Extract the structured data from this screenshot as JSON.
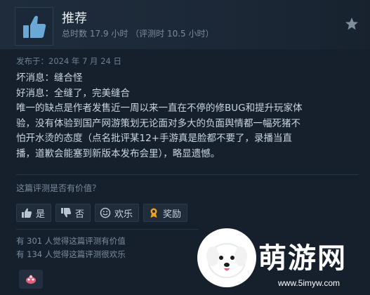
{
  "review": {
    "verdict": "推荐",
    "playtime": "总时数 17.9 小时 （评测时 10.5 小时）",
    "posted": "发布于：2024 年 7 月 24 日",
    "lines": [
      "坏消息：缝合怪",
      "好消息：全缝了，完美缝合",
      "唯一的缺点是作者发售近一周以来一直在不停的修BUG和提升玩家体",
      "验，没有体验到国产网游策划无论面对多大的负面舆情都一幅死猪不",
      "怕开水烫的态度（点名批评某12+手游真是脸都不要了，录播当直",
      "播，道歉会能塞到新版本发布会里），略显遗憾。"
    ]
  },
  "helpful": {
    "question": "这篇评测是否有价值？",
    "buttons": {
      "yes": "是",
      "no": "否",
      "funny": "欢乐",
      "award": "奖励"
    },
    "helpful_count_text": "有 301 人觉得这篇评测有价值",
    "funny_count_text": "有 134 人觉得这篇评测很欢乐"
  },
  "watermark": {
    "brand": "萌游网",
    "url": "www.5imyw.com"
  },
  "colors": {
    "background": "#16202d",
    "header": "#1c2837",
    "thumb_blue": "#6aa9d6",
    "award_orange": "#f0a11d"
  },
  "icons": {
    "verdict": "thumbs-up-icon",
    "favorite": "star-icon",
    "yes": "thumbs-up-icon",
    "no": "thumbs-down-icon",
    "funny": "smiley-icon",
    "award": "award-icon"
  }
}
